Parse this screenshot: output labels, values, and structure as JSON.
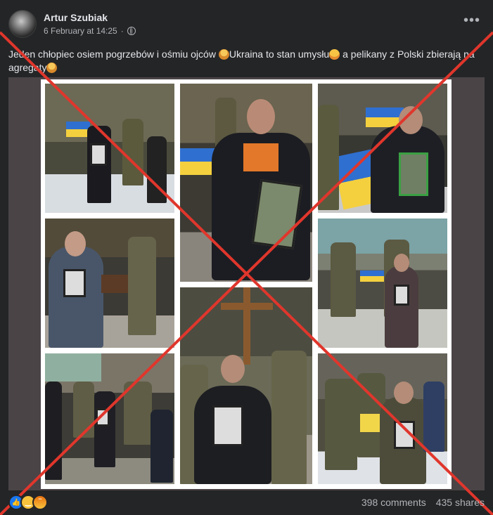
{
  "post": {
    "author": "Artur Szubiak",
    "timestamp": "6 February at 14:25",
    "privacy_icon": "globe-icon",
    "more_label": "•••",
    "caption_parts": {
      "part1": "Jeden chłopiec osiem pogrzebów i ośmiu ojców ",
      "part2": "Ukraina to stan umysłu",
      "part3": " a pelikany z Polski zbierają na agregaty"
    },
    "emojis": [
      "person-shrugging-emoji",
      "grinning-face-emoji",
      "person-shrugging-emoji"
    ]
  },
  "media": {
    "photo_count": 8,
    "overlay": "red-cross-mark",
    "overlay_color": "#e0362c"
  },
  "footer": {
    "reactions": [
      "like-reaction-icon",
      "haha-reaction-icon",
      "angry-reaction-icon"
    ],
    "comments": "398 comments",
    "shares": "435 shares"
  },
  "colors": {
    "background": "#242526",
    "text": "#e4e6eb",
    "secondary_text": "#b0b3b8",
    "like_blue": "#1877f2"
  }
}
